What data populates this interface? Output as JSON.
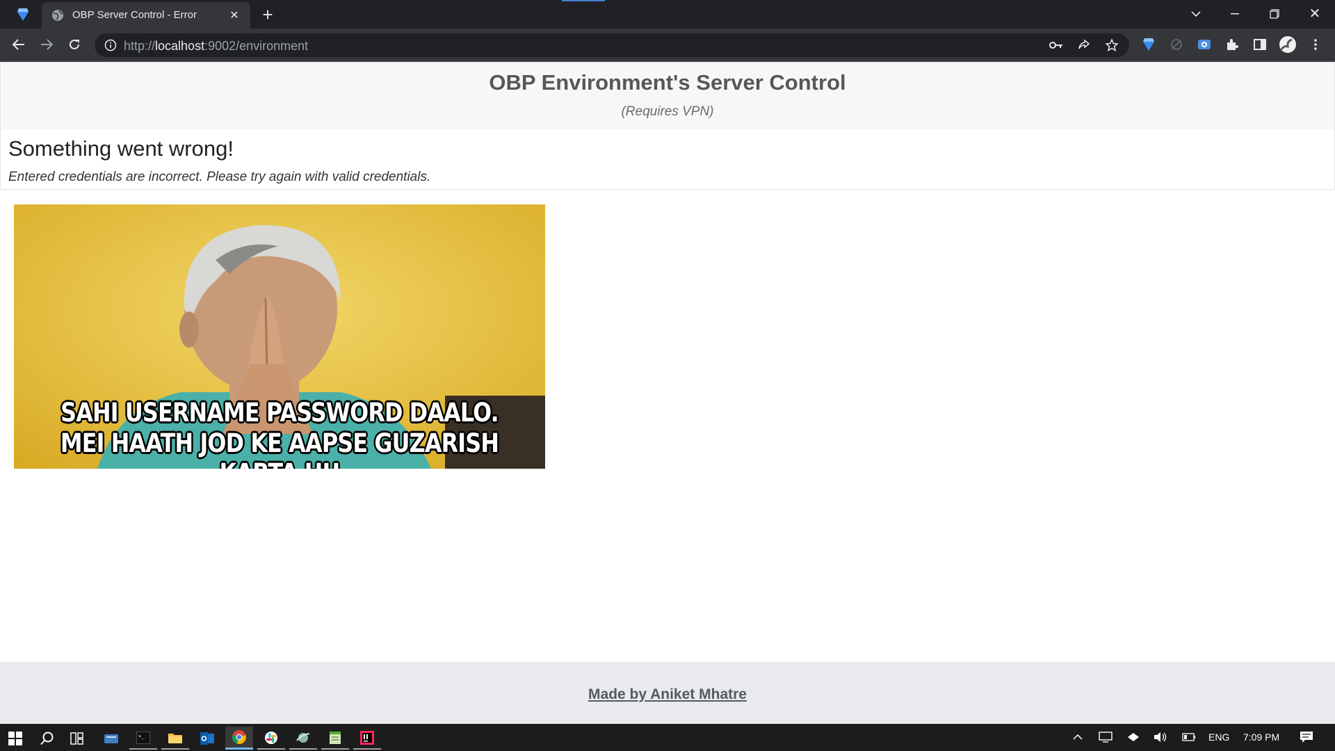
{
  "browser": {
    "tab_title": "OBP Server Control - Error",
    "url_host": "localhost",
    "url_prefix": "http://",
    "url_suffix": ":9002/environment",
    "icons": [
      "gem-favicon",
      "globe-favicon",
      "close-icon",
      "new-tab-icon",
      "tab-search-icon",
      "minimize-icon",
      "restore-icon",
      "window-close-icon",
      "back-icon",
      "forward-icon",
      "reload-icon",
      "site-info-icon",
      "key-icon",
      "share-icon",
      "star-icon",
      "extension-gem-icon",
      "extension-disabled-icon",
      "screen-capture-icon",
      "puzzle-icon",
      "side-panel-icon",
      "profile-avatar",
      "menu-icon"
    ]
  },
  "header": {
    "title": "OBP Environment's Server Control",
    "subtitle": "(Requires VPN)"
  },
  "alert": {
    "heading": "Something went wrong!",
    "message": "Entered credentials are incorrect. Please try again with valid credentials."
  },
  "meme": {
    "line1": "SAHI USERNAME PASSWORD DAALO.",
    "line2": "MEI HAATH JOD KE AAPSE GUZARISH KARTA HU"
  },
  "footer": {
    "link": "Made by Aniket Mhatre"
  },
  "taskbar": {
    "apps": [
      "windows-start-icon",
      "search-icon",
      "task-view-icon",
      "app-blue-icon",
      "terminal-icon",
      "file-explorer-icon",
      "outlook-icon",
      "chrome-icon",
      "slack-icon",
      "app-bird-icon",
      "notepad-icon",
      "intellij-icon"
    ],
    "tray_icons": [
      "chevron-up-icon",
      "network-display-icon",
      "wifi-icon",
      "volume-icon",
      "battery-icon",
      "notification-icon"
    ],
    "language": "ENG",
    "time": "7:09 PM"
  },
  "colors": {
    "chrome_dark": "#202124",
    "toolbar": "#35363a",
    "header_bg": "#f7f7f7",
    "footer_bg": "#e9ebee",
    "taskbar": "#1c1c1c",
    "accent_blue": "#76b9ed"
  }
}
